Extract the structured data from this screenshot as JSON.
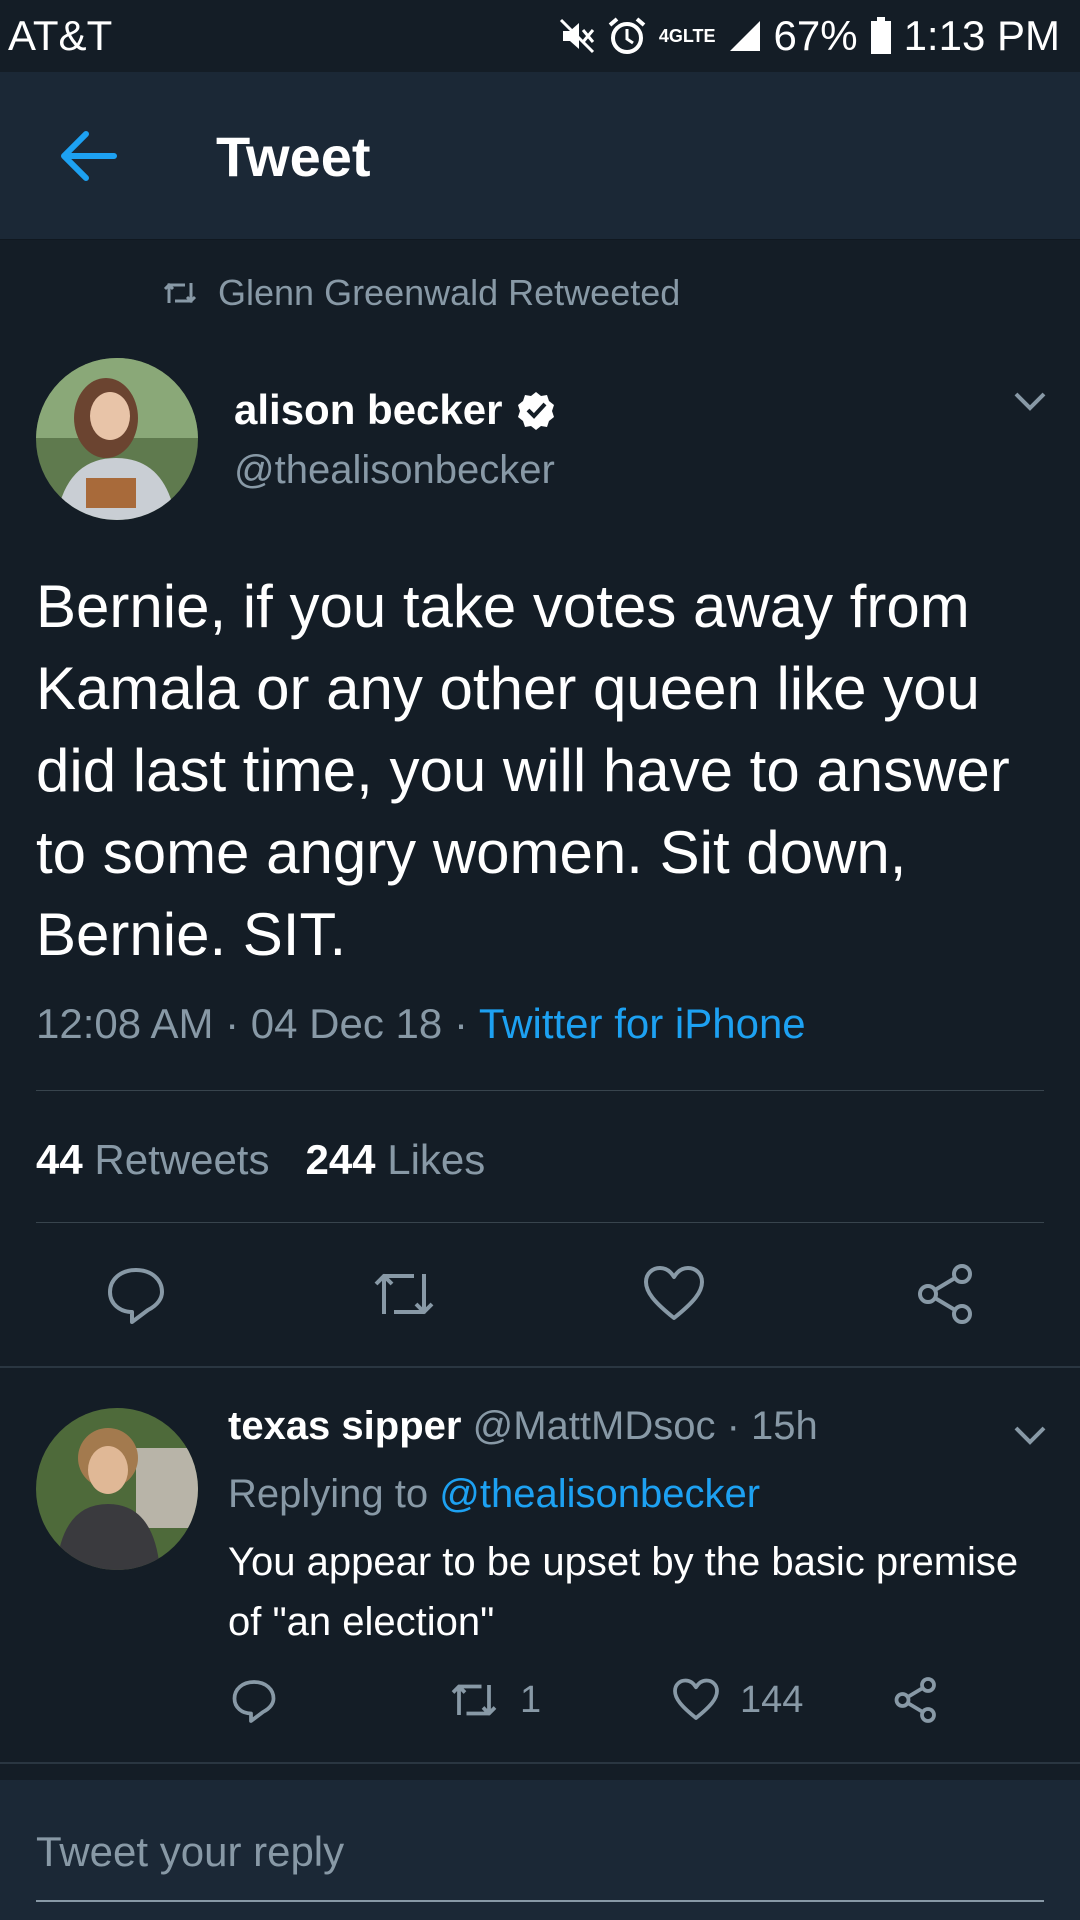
{
  "status_bar": {
    "carrier": "AT&T",
    "network": "4G",
    "network_sub": "LTE",
    "battery": "67%",
    "time": "1:13 PM"
  },
  "app_bar": {
    "title": "Tweet",
    "back_icon": "arrow-left-icon"
  },
  "colors": {
    "background": "#141d26",
    "bar": "#1b2836",
    "accent": "#1da1f2",
    "secondary_text": "#8899a6"
  },
  "tweet": {
    "retweeted_by": "Glenn Greenwald Retweeted",
    "author_name": "alison becker",
    "author_handle": "@thealisonbecker",
    "verified": true,
    "text": "Bernie, if you take votes away from Kamala or any other queen like you did last time, you will have to answer to some angry women. Sit down, Bernie. SIT.",
    "time": "12:08 AM",
    "date": "04 Dec 18",
    "source": "Twitter for iPhone",
    "retweets": "44",
    "retweets_label": "Retweets",
    "likes": "244",
    "likes_label": "Likes"
  },
  "reply": {
    "name": "texas sipper",
    "handle": "@MattMDsoc",
    "age": "15h",
    "replying_to_label": "Replying to",
    "replying_to_handle": "@thealisonbecker",
    "text": "You appear to be upset by the basic premise of \"an election\"",
    "retweets": "1",
    "likes": "144"
  },
  "compose": {
    "placeholder": "Tweet your reply"
  }
}
